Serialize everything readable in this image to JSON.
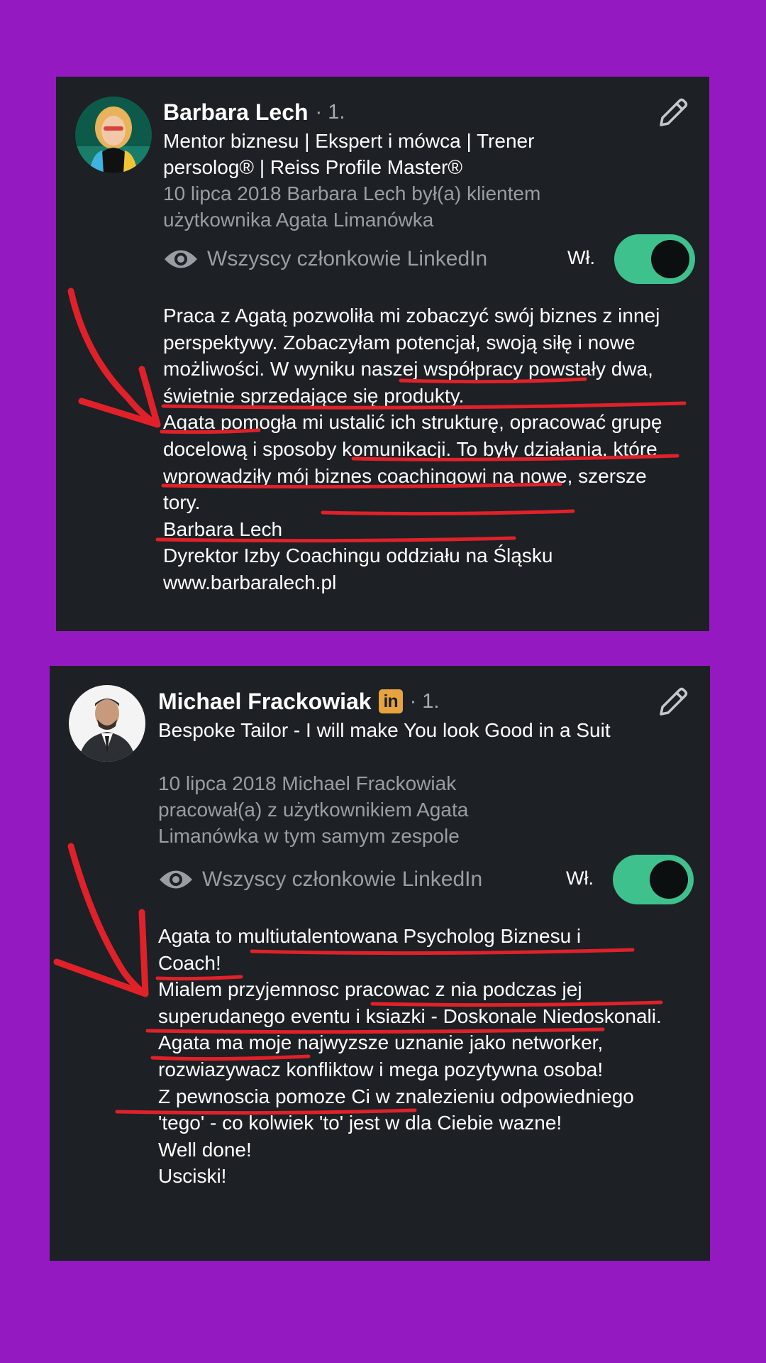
{
  "recommendations": [
    {
      "name": "Barbara Lech",
      "degree": "· 1.",
      "headline": "Mentor biznesu | Ekspert i mówca | Trener persolog® | Reiss Profile Master®",
      "relation": "10 lipca 2018 Barbara Lech był(a) klientem użytkownika Agata Limanówka",
      "visibility": "Wszyscy członkowie LinkedIn",
      "toggle_label": "Wł.",
      "toggle_on": true,
      "body": [
        "Praca z Agatą pozwoliła mi zobaczyć swój biznes z innej perspektywy. Zobaczyłam potencjał, swoją siłę i nowe możliwości. W wyniku naszej współpracy powstały dwa, świetnie sprzedające się produkty.",
        "Agata pomogła mi ustalić ich strukturę, opracować grupę docelową i sposoby komunikacji. To były działania, które wprowadziły mój biznes coachingowi na nowe, szersze tory.",
        "Barbara Lech",
        "Dyrektor Izby Coachingu oddziału na Śląsku",
        "www.barbaralech.pl"
      ]
    },
    {
      "name": "Michael Frackowiak",
      "badge": "in",
      "degree": "· 1.",
      "headline": "Bespoke Tailor - I will make You look Good in a Suit",
      "relation": "10 lipca 2018 Michael Frackowiak pracował(a) z użytkownikiem Agata Limanówka w tym samym zespole",
      "visibility": "Wszyscy członkowie LinkedIn",
      "toggle_label": "Wł.",
      "toggle_on": true,
      "body": [
        "Agata to multiutalentowana Psycholog Biznesu i Coach!",
        "Mialem przyjemnosc pracowac z nia podczas jej superudanego eventu i ksiazki - Doskonale Niedoskonali.",
        "Agata ma moje najwyzsze uznanie jako networker, rozwiazywacz konfliktow i mega pozytywna osoba!",
        "Z pewnoscia pomoze Ci w znalezieniu odpowiedniego 'tego' - co kolwiek 'to' jest w dla Ciebie wazne!",
        "Well done!",
        "Usciski!"
      ]
    }
  ],
  "colors": {
    "background": "#9519c0",
    "card": "#1d2024",
    "toggle": "#3ec18d",
    "annotation": "#e0212a",
    "linkedin_badge": "#e7a33e"
  },
  "icons": [
    "avatar",
    "pencil-icon",
    "eye-icon",
    "linkedin-badge-icon",
    "red-arrow-annotation"
  ]
}
